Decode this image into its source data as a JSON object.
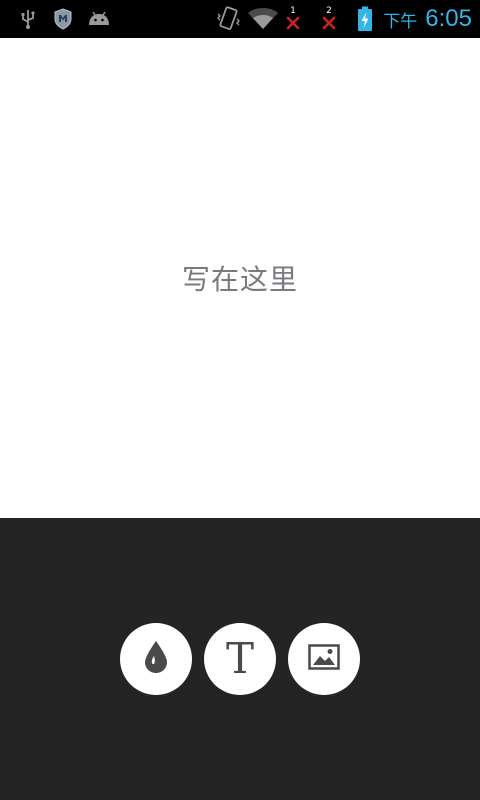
{
  "status_bar": {
    "ampm": "下午",
    "time": "6:05",
    "sim1_label": "1",
    "sim2_label": "2",
    "icons": [
      "usb-icon",
      "security-shield-icon",
      "android-icon",
      "vibrate-icon",
      "wifi-icon",
      "sim1-no-signal-icon",
      "sim2-no-signal-icon",
      "battery-charging-icon"
    ],
    "accent_color": "#33b5e5"
  },
  "canvas": {
    "placeholder": "写在这里"
  },
  "toolbar": {
    "buttons": [
      {
        "id": "color",
        "icon": "water-drop-icon"
      },
      {
        "id": "text",
        "label": "T",
        "icon": "text-T-icon"
      },
      {
        "id": "image",
        "icon": "image-icon"
      }
    ],
    "background": "#242424"
  }
}
